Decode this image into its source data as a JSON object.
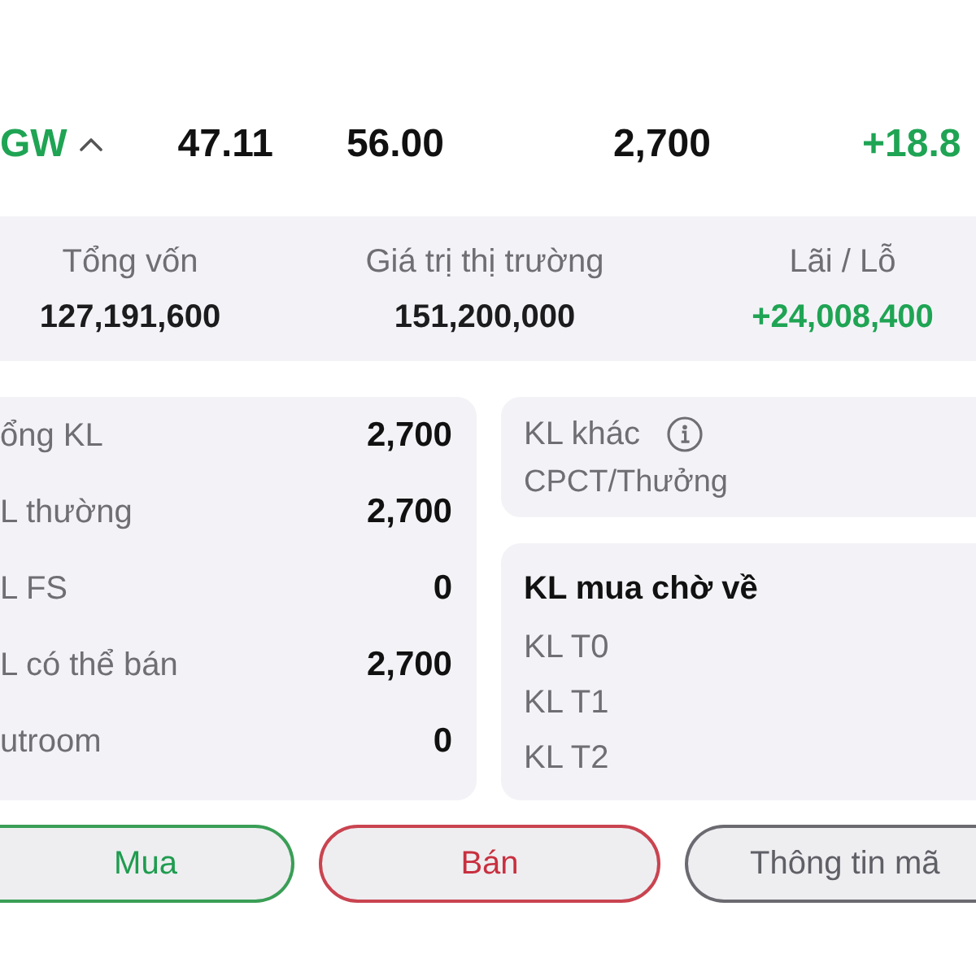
{
  "quote_row": {
    "symbol": "GW",
    "expanded": true,
    "values": [
      "47.11",
      "56.00",
      "2,700"
    ],
    "change": "+18.8",
    "rising": true
  },
  "summary": [
    {
      "label": "Tổng vốn",
      "value": "127,191,600",
      "color": "#1c1c1e"
    },
    {
      "label": "Giá trị thị trường",
      "value": "151,200,000",
      "color": "#1c1c1e"
    },
    {
      "label": "Lãi / Lỗ",
      "value": "+24,008,400",
      "color": "#1fa454"
    }
  ],
  "volumes": [
    {
      "label": "ổng KL",
      "value": "2,700"
    },
    {
      "label": "L thường",
      "value": "2,700"
    },
    {
      "label": "L FS",
      "value": "0"
    },
    {
      "label": "L có thể bán",
      "value": "2,700"
    },
    {
      "label": "utroom",
      "value": "0"
    }
  ],
  "other_volume": {
    "title": "KL khác",
    "note": "CPCT/Thưởng"
  },
  "pending_buy": {
    "title": "KL mua chờ về",
    "rows": [
      "KL T0",
      "KL T1",
      "KL T2"
    ]
  },
  "actions": [
    {
      "label": "Mua",
      "kind": "buy"
    },
    {
      "label": "Bán",
      "kind": "sell"
    },
    {
      "label": "Thông tin mã",
      "kind": "info"
    }
  ]
}
